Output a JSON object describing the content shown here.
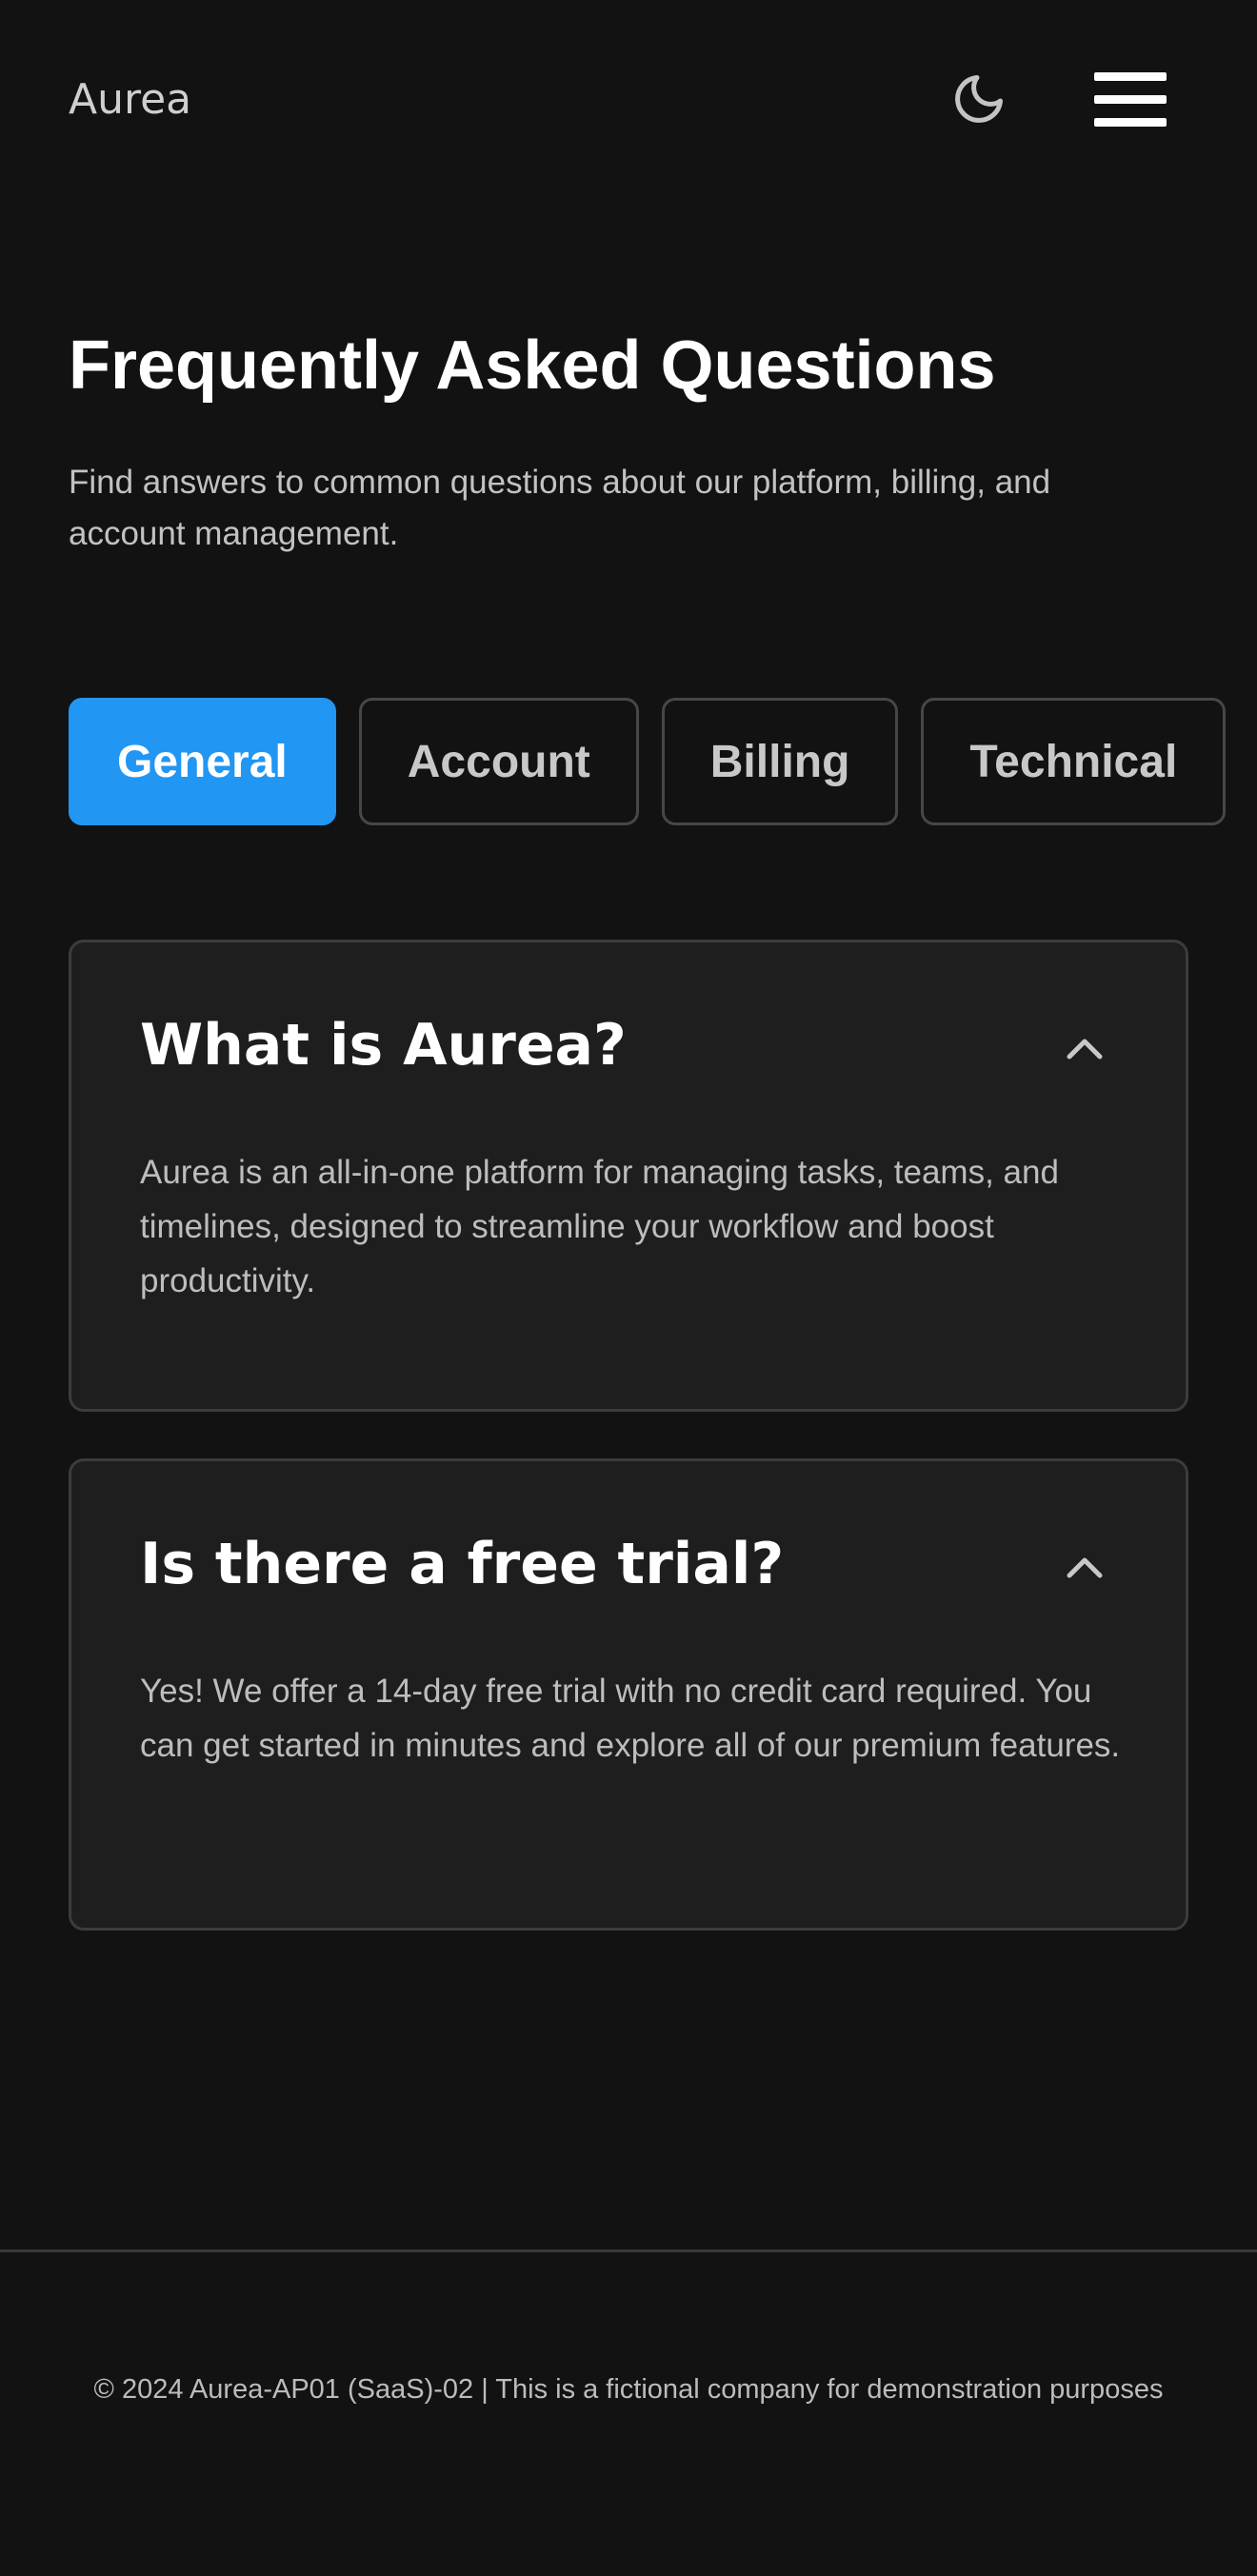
{
  "header": {
    "logo": "Aurea",
    "theme_icon": "moon-icon",
    "menu_icon": "hamburger-menu-icon"
  },
  "main": {
    "title": "Frequently Asked Questions",
    "subtitle": "Find answers to common questions about our platform, billing, and account management.",
    "tabs": [
      {
        "label": "General",
        "active": true
      },
      {
        "label": "Account",
        "active": false
      },
      {
        "label": "Billing",
        "active": false
      },
      {
        "label": "Technical",
        "active": false
      }
    ],
    "faqs": [
      {
        "question": "What is Aurea?",
        "answer": "Aurea is an all-in-one platform for managing tasks, teams, and timelines, designed to streamline your workflow and boost productivity.",
        "expanded": true
      },
      {
        "question": "Is there a free trial?",
        "answer": "Yes! We offer a 14-day free trial with no credit card required. You can get started in minutes and explore all of our premium features.",
        "expanded": true
      }
    ]
  },
  "footer": {
    "text": "© 2024 Aurea-AP01 (SaaS)-02 | This is a fictional company for demonstration purposes"
  },
  "colors": {
    "background": "#121212",
    "card": "#1e1e1e",
    "accent": "#2196f3",
    "border": "#3c3c3c"
  }
}
